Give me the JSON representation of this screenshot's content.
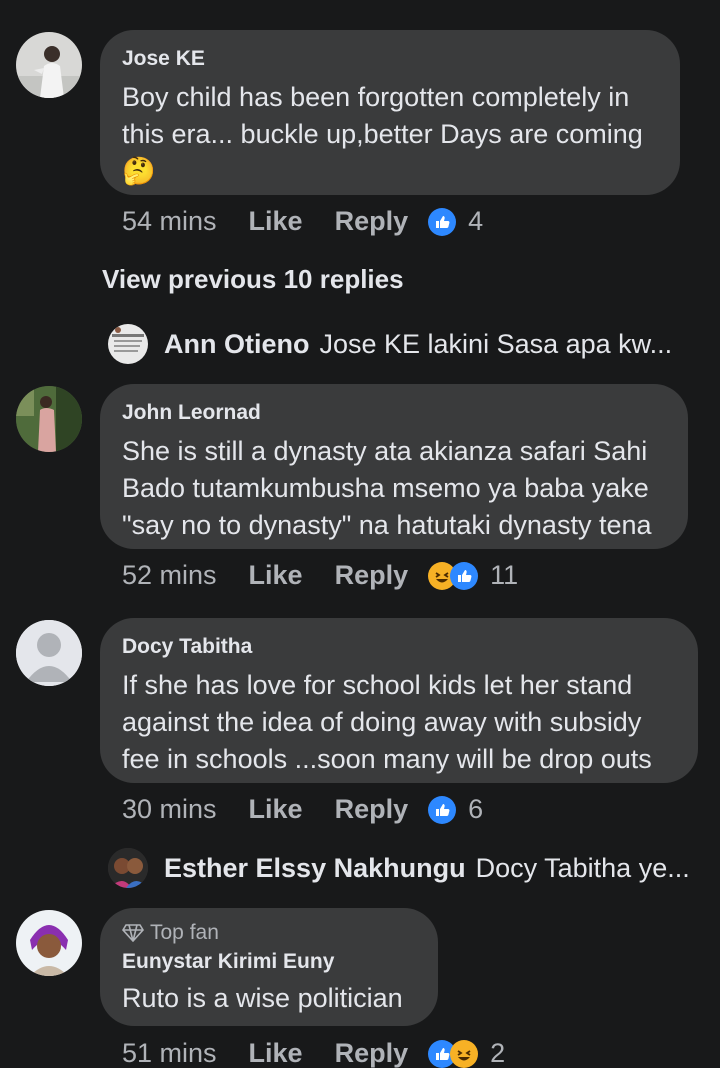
{
  "comments": [
    {
      "author": "Jose KE",
      "text": "Boy child has been forgotten completely in\nthis era... buckle up,better Days are coming",
      "emoji": "🤔",
      "time": "54 mins",
      "like": "Like",
      "reply": "Reply",
      "reaction_count": "4",
      "reactions": [
        "like"
      ]
    },
    {
      "author": "John Leornad",
      "text": "She is still a dynasty ata akianza safari Sahi\nBado tutamkumbusha msemo ya baba yake\n\"say no to dynasty\" na hatutaki dynasty tena",
      "time": "52 mins",
      "like": "Like",
      "reply": "Reply",
      "reaction_count": "11",
      "reactions": [
        "haha",
        "like"
      ]
    },
    {
      "author": "Docy Tabitha",
      "text": "If she has love for school kids let her stand\nagainst the idea of doing away with subsidy\nfee in schools ...soon many will be drop outs",
      "time": "30 mins",
      "like": "Like",
      "reply": "Reply",
      "reaction_count": "6",
      "reactions": [
        "like"
      ]
    },
    {
      "badge": "Top fan",
      "author": "Eunystar Kirimi Euny",
      "text": "Ruto is a wise politician",
      "time": "51 mins",
      "like": "Like",
      "reply": "Reply",
      "reaction_count": "2",
      "reactions": [
        "like",
        "haha"
      ]
    }
  ],
  "view_previous": "View previous 10 replies",
  "replies": [
    {
      "name": "Ann Otieno",
      "preview": "Jose KE lakini Sasa apa kw..."
    },
    {
      "name": "Esther Elssy Nakhungu",
      "preview": "Docy Tabitha ye..."
    }
  ],
  "colors": {
    "background": "#18191a",
    "bubble": "#3a3b3c",
    "text": "#e4e6eb",
    "muted": "#b0b3b8",
    "like_blue": "#2d88ff",
    "haha_yellow": "#f7b125"
  }
}
